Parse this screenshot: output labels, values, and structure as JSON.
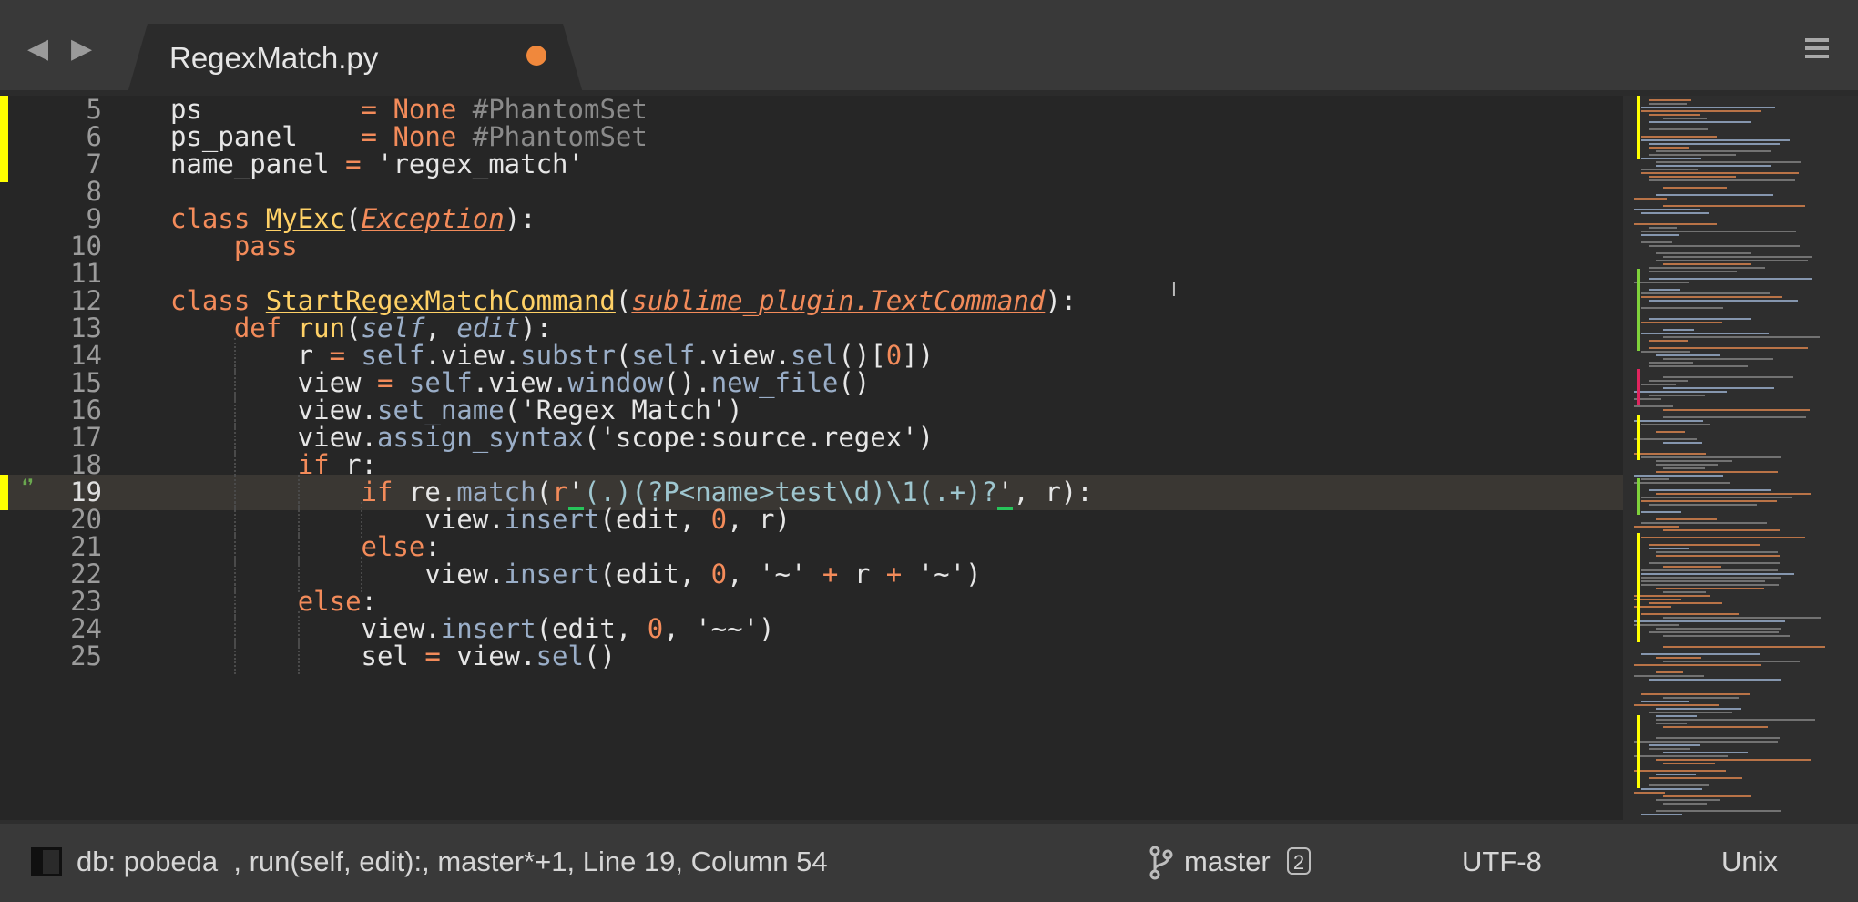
{
  "tab": {
    "title": "RegexMatch.py",
    "dirty_color": "#f0883c"
  },
  "lines": [
    {
      "n": "5",
      "mark": true,
      "html": "ps          <span class='op'>=</span> <span class='kw'>None</span> <span class='cmt'>#PhantomSet</span>"
    },
    {
      "n": "6",
      "mark": true,
      "html": "ps_panel    <span class='op'>=</span> <span class='kw'>None</span> <span class='cmt'>#PhantomSet</span>"
    },
    {
      "n": "7",
      "mark": true,
      "html": "name_panel <span class='op'>=</span> <span class='str'>'regex_match'</span>"
    },
    {
      "n": "8",
      "mark": false,
      "html": ""
    },
    {
      "n": "9",
      "mark": false,
      "html": "<span class='kw'>class</span> <span class='cls'>MyExc</span>(<span class='base'>Exception</span>):"
    },
    {
      "n": "10",
      "mark": false,
      "html": "    <span class='kw'>pass</span>"
    },
    {
      "n": "11",
      "mark": false,
      "html": ""
    },
    {
      "n": "12",
      "mark": false,
      "html": "<span class='kw'>class</span> <span class='cls'>StartRegexMatchCommand</span>(<span class='base'>sublime_plugin.TextCommand</span>):"
    },
    {
      "n": "13",
      "mark": false,
      "html": "    <span class='kw'>def</span> <span class='cls' style='text-decoration:none'>run</span>(<span class='prm'>self</span>, <span class='prm'>edit</span>):"
    },
    {
      "n": "14",
      "mark": false,
      "html": "        r <span class='op'>=</span> <span class='attr'>self</span>.view.<span class='attr'>substr</span>(<span class='attr'>self</span>.view.<span class='attr'>sel</span>()[<span class='num'>0</span>])"
    },
    {
      "n": "15",
      "mark": false,
      "html": "        view <span class='op'>=</span> <span class='attr'>self</span>.view.<span class='attr'>window</span>().<span class='attr'>new_file</span>()"
    },
    {
      "n": "16",
      "mark": false,
      "html": "        view.<span class='attr'>set_name</span>(<span class='str'>'Regex Match'</span>)"
    },
    {
      "n": "17",
      "mark": false,
      "html": "        view.<span class='attr'>assign_syntax</span>(<span class='str'>'scope:source.regex'</span>)"
    },
    {
      "n": "18",
      "mark": false,
      "html": "        <span class='kw'>if</span> r:"
    },
    {
      "n": "19",
      "mark": true,
      "current": true,
      "html": "            <span class='kw'>if</span> re.<span class='attr'>match</span>(<span class='kw'>r</span><span class='grn-under'>'</span><span class='rx'>(.)(?P&lt;name&gt;test\\d)\\1(.+)?</span><span class='grn-under'>'</span>, r):"
    },
    {
      "n": "20",
      "mark": false,
      "html": "                view.<span class='attr'>insert</span>(edit, <span class='num'>0</span>, r)"
    },
    {
      "n": "21",
      "mark": false,
      "html": "            <span class='kw'>else</span>:"
    },
    {
      "n": "22",
      "mark": false,
      "html": "                view.<span class='attr'>insert</span>(edit, <span class='num'>0</span>, <span class='str'>'~'</span> <span class='op'>+</span> r <span class='op'>+</span> <span class='str'>'~'</span>)"
    },
    {
      "n": "23",
      "mark": false,
      "html": "        <span class='kw'>else</span>:"
    },
    {
      "n": "24",
      "mark": false,
      "html": "            view.<span class='attr'>insert</span>(edit, <span class='num'>0</span>, <span class='str'>'~~'</span>)"
    },
    {
      "n": "25",
      "mark": false,
      "html": "            sel <span class='op'>=</span> view.<span class='attr'>sel</span>()"
    }
  ],
  "status": {
    "text": "db: pobeda  , run(self, edit):, master*+1, Line 19, Column 54",
    "branch": "master",
    "branch_count": "2",
    "encoding": "UTF-8",
    "line_endings": "Unix"
  },
  "colors": {
    "gutter_mark": "#ffff00",
    "keyword": "#f38b5a",
    "class_name": "#ffd166",
    "param": "#9aaec8"
  }
}
